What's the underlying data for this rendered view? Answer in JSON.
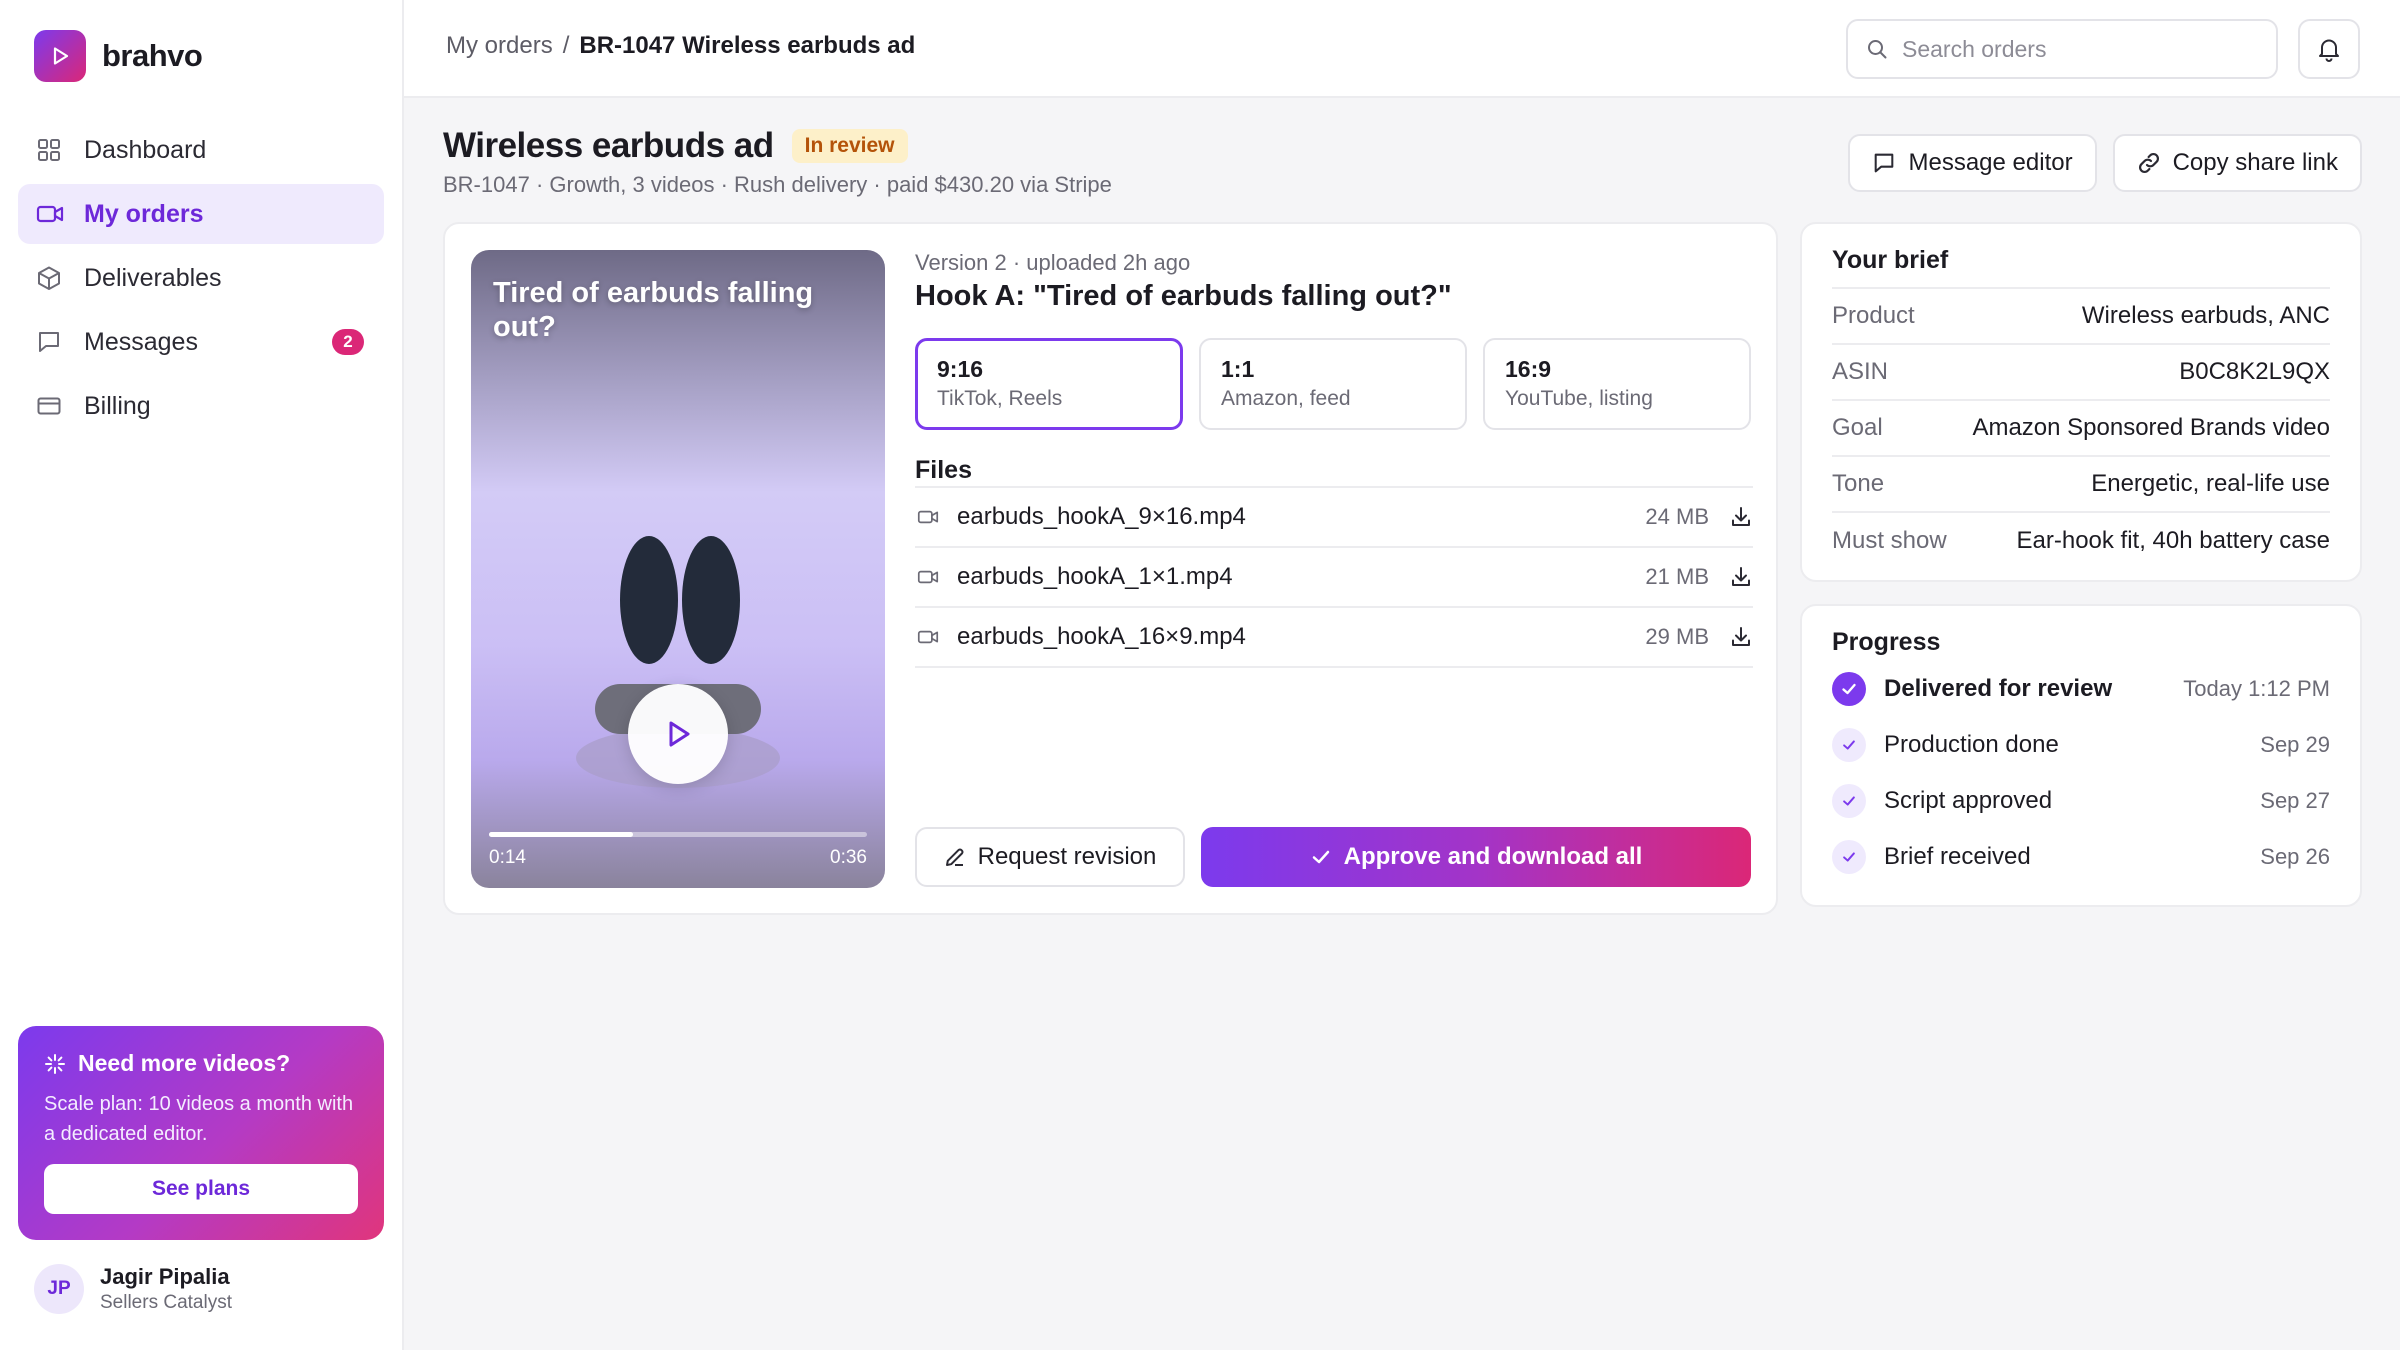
{
  "brand": {
    "name": "brahvo",
    "colors": {
      "accent": "#7c3aed",
      "accent_end": "#db2777"
    }
  },
  "sidebar": {
    "items": [
      {
        "label": "Dashboard",
        "icon": "grid-icon"
      },
      {
        "label": "My orders",
        "icon": "video-icon",
        "active": true
      },
      {
        "label": "Deliverables",
        "icon": "box-icon"
      },
      {
        "label": "Messages",
        "icon": "message-icon",
        "badge": "2"
      },
      {
        "label": "Billing",
        "icon": "credit-card-icon"
      }
    ],
    "promo": {
      "title": "Need more videos?",
      "text": "Scale plan: 10 videos a month with a dedicated editor.",
      "button": "See plans"
    },
    "user": {
      "initials": "JP",
      "name": "Jagir Pipalia",
      "org": "Sellers Catalyst"
    }
  },
  "topbar": {
    "breadcrumb": {
      "parent": "My orders",
      "separator": "/",
      "current": "BR-1047 Wireless earbuds ad"
    },
    "search_placeholder": "Search orders"
  },
  "order": {
    "title": "Wireless earbuds ad",
    "status": "In review",
    "meta": "BR-1047 · Growth, 3 videos · Rush delivery · paid $430.20 via Stripe",
    "actions": {
      "message": "Message editor",
      "share": "Copy share link"
    }
  },
  "player": {
    "caption": "Tired of earbuds falling out?",
    "current_time": "0:14",
    "duration": "0:36",
    "progress": 0.38
  },
  "version": {
    "line": "Version 2 · uploaded 2h ago",
    "hook": "Hook A: \"Tired of earbuds falling out?\"",
    "formats": [
      {
        "ratio": "9:16",
        "use": "TikTok, Reels",
        "selected": true
      },
      {
        "ratio": "1:1",
        "use": "Amazon, feed",
        "selected": false
      },
      {
        "ratio": "16:9",
        "use": "YouTube, listing",
        "selected": false
      }
    ]
  },
  "files": {
    "title": "Files",
    "items": [
      {
        "name": "earbuds_hookA_9×16.mp4",
        "size": "24 MB"
      },
      {
        "name": "earbuds_hookA_1×1.mp4",
        "size": "21 MB"
      },
      {
        "name": "earbuds_hookA_16×9.mp4",
        "size": "29 MB"
      }
    ]
  },
  "card_actions": {
    "revision": "Request revision",
    "approve": "Approve and download all"
  },
  "brief": {
    "title": "Your brief",
    "rows": [
      {
        "label": "Product",
        "value": "Wireless earbuds, ANC"
      },
      {
        "label": "ASIN",
        "value": "B0C8K2L9QX"
      },
      {
        "label": "Goal",
        "value": "Amazon Sponsored Brands video"
      },
      {
        "label": "Tone",
        "value": "Energetic, real-life use"
      },
      {
        "label": "Must show",
        "value": "Ear-hook fit, 40h battery case"
      }
    ]
  },
  "progress": {
    "title": "Progress",
    "steps": [
      {
        "label": "Delivered for review",
        "date": "Today 1:12 PM",
        "current": true
      },
      {
        "label": "Production done",
        "date": "Sep 29"
      },
      {
        "label": "Script approved",
        "date": "Sep 27"
      },
      {
        "label": "Brief received",
        "date": "Sep 26"
      }
    ]
  }
}
